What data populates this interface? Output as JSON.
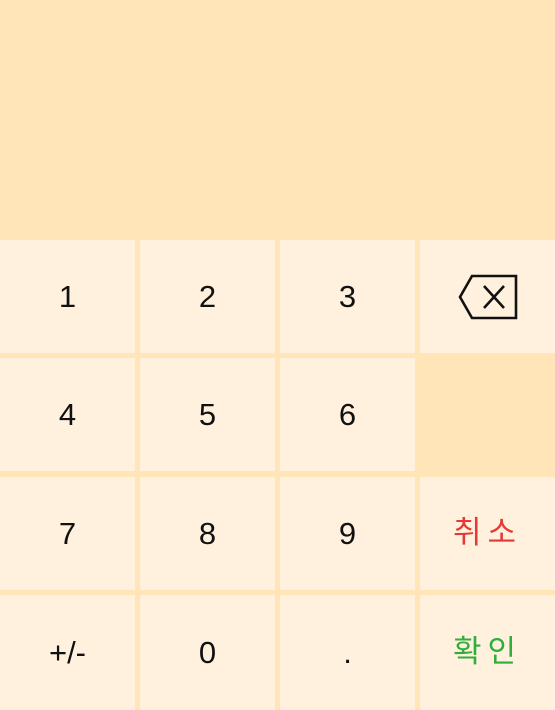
{
  "display": {
    "value": ""
  },
  "keys": {
    "one": "1",
    "two": "2",
    "three": "3",
    "four": "4",
    "five": "5",
    "six": "6",
    "seven": "7",
    "eight": "8",
    "nine": "9",
    "plus_minus": "+/-",
    "zero": "0",
    "decimal": ".",
    "backspace_icon": "backspace-icon",
    "cancel": "취소",
    "confirm": "확인"
  },
  "colors": {
    "display_background": "#ffe5b7",
    "key_background": "#fff1dd",
    "digit_text": "#111111",
    "cancel_text": "#e53935",
    "confirm_text": "#2fae3a"
  }
}
